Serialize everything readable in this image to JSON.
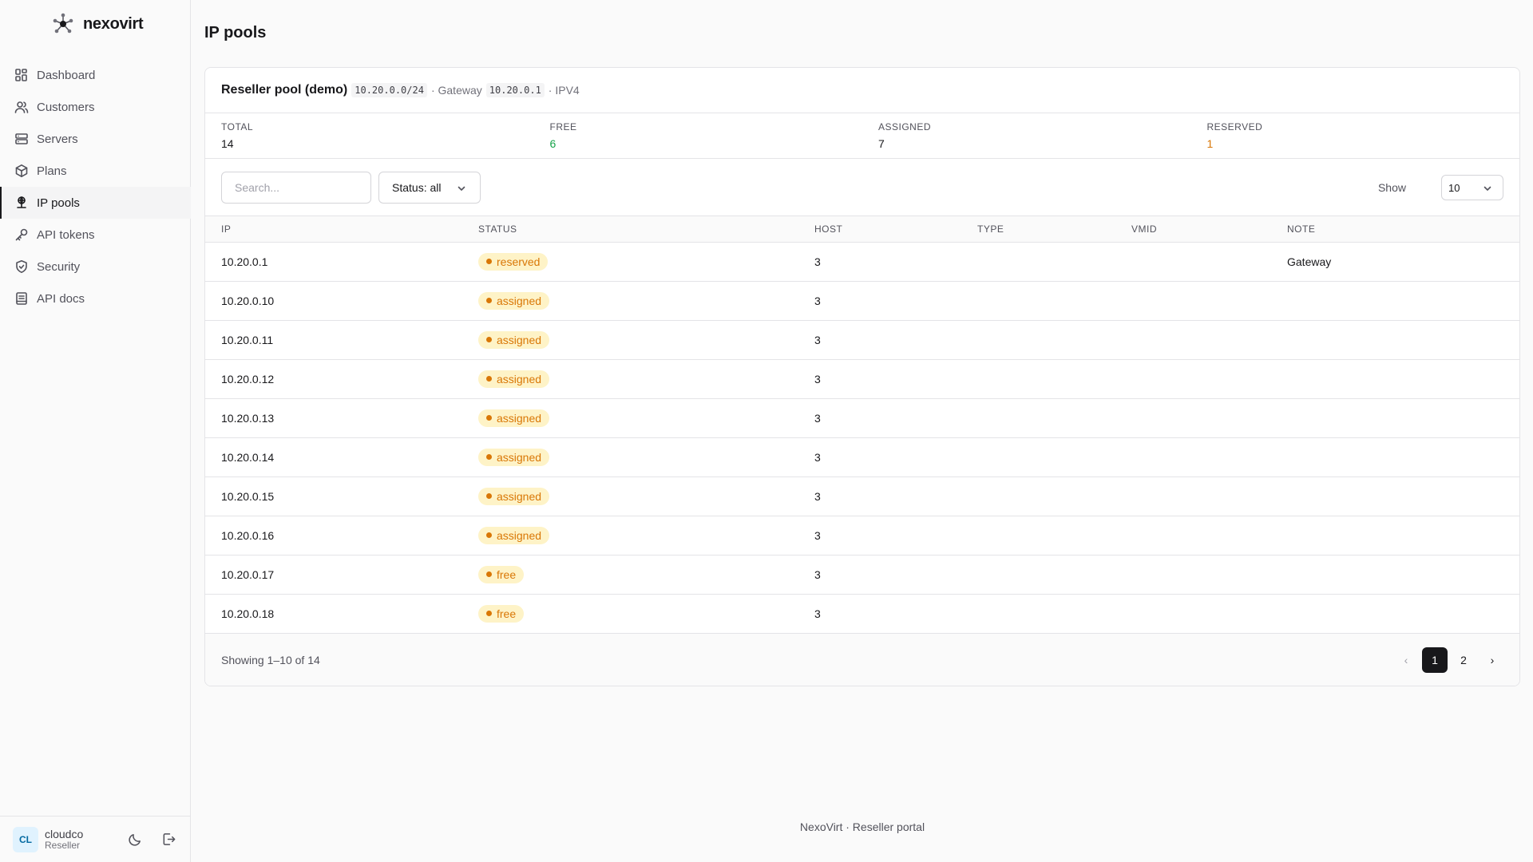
{
  "brand": {
    "name": "nexovirt"
  },
  "sidebar": {
    "items": [
      {
        "label": "Dashboard",
        "icon": "dashboard-icon",
        "active": false
      },
      {
        "label": "Customers",
        "icon": "users-icon",
        "active": false
      },
      {
        "label": "Servers",
        "icon": "server-icon",
        "active": false
      },
      {
        "label": "Plans",
        "icon": "box-icon",
        "active": false
      },
      {
        "label": "IP pools",
        "icon": "network-icon",
        "active": true
      },
      {
        "label": "API tokens",
        "icon": "key-icon",
        "active": false
      },
      {
        "label": "Security",
        "icon": "shield-icon",
        "active": false
      },
      {
        "label": "API docs",
        "icon": "book-icon",
        "active": false
      }
    ]
  },
  "user": {
    "initials": "CL",
    "name": "cloudco",
    "role": "Reseller"
  },
  "page": {
    "title": "IP pools"
  },
  "pool": {
    "name": "Reseller pool (demo)",
    "cidr": "10.20.0.0/24",
    "gateway_label": "· Gateway",
    "gateway": "10.20.0.1",
    "family": "· IPV4"
  },
  "stats": {
    "total_label": "TOTAL",
    "total": "14",
    "free_label": "FREE",
    "free": "6",
    "assigned_label": "ASSIGNED",
    "assigned": "7",
    "reserved_label": "RESERVED",
    "reserved": "1"
  },
  "toolbar": {
    "search_placeholder": "Search...",
    "status_filter": "Status: all",
    "show_label": "Show",
    "page_size": "10"
  },
  "table": {
    "columns": [
      "IP",
      "STATUS",
      "HOST",
      "TYPE",
      "VMID",
      "NOTE"
    ],
    "rows": [
      {
        "ip": "10.20.0.1",
        "status": "reserved",
        "host": "3",
        "type": "",
        "vmid": "",
        "note": "Gateway"
      },
      {
        "ip": "10.20.0.10",
        "status": "assigned",
        "host": "3",
        "type": "",
        "vmid": "",
        "note": ""
      },
      {
        "ip": "10.20.0.11",
        "status": "assigned",
        "host": "3",
        "type": "",
        "vmid": "",
        "note": ""
      },
      {
        "ip": "10.20.0.12",
        "status": "assigned",
        "host": "3",
        "type": "",
        "vmid": "",
        "note": ""
      },
      {
        "ip": "10.20.0.13",
        "status": "assigned",
        "host": "3",
        "type": "",
        "vmid": "",
        "note": ""
      },
      {
        "ip": "10.20.0.14",
        "status": "assigned",
        "host": "3",
        "type": "",
        "vmid": "",
        "note": ""
      },
      {
        "ip": "10.20.0.15",
        "status": "assigned",
        "host": "3",
        "type": "",
        "vmid": "",
        "note": ""
      },
      {
        "ip": "10.20.0.16",
        "status": "assigned",
        "host": "3",
        "type": "",
        "vmid": "",
        "note": ""
      },
      {
        "ip": "10.20.0.17",
        "status": "free",
        "host": "3",
        "type": "",
        "vmid": "",
        "note": ""
      },
      {
        "ip": "10.20.0.18",
        "status": "free",
        "host": "3",
        "type": "",
        "vmid": "",
        "note": ""
      }
    ]
  },
  "pagination": {
    "showing": "Showing 1–10 of 14",
    "prev": "‹",
    "pages": [
      "1",
      "2"
    ],
    "current": "1",
    "next": "›"
  },
  "footer": {
    "text": "NexoVirt · Reseller portal"
  },
  "colors": {
    "accent": "#18181b",
    "badge_bg": "#fef3c7",
    "badge_fg": "#d97706",
    "free": "#16a34a"
  }
}
